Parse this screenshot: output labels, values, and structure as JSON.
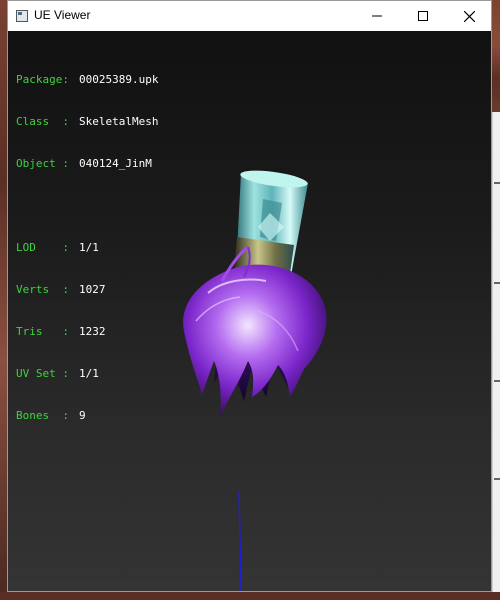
{
  "window": {
    "title": "UE Viewer",
    "controls": [
      "minimize",
      "maximize",
      "close"
    ]
  },
  "info": {
    "package": {
      "label": "Package:",
      "value": "00025389.upk"
    },
    "class": {
      "label": "Class  :",
      "value": "SkeletalMesh"
    },
    "object": {
      "label": "Object :",
      "value": "040124_JinM"
    },
    "lod": {
      "label": "LOD    :",
      "value": "1/1"
    },
    "verts": {
      "label": "Verts  :",
      "value": "1027"
    },
    "tris": {
      "label": "Tris   :",
      "value": "1232"
    },
    "uvset": {
      "label": "UV Set :",
      "value": "1/1"
    },
    "bones": {
      "label": "Bones  :",
      "value": "9"
    }
  },
  "colors": {
    "label": "#3fd23f",
    "value": "#ffffff",
    "viewport_top": "#111111",
    "viewport_bottom": "#343434",
    "hair_primary": "#9b3fd8",
    "cylinder": "#8fd6d0",
    "axis": "#1f1fd6"
  },
  "icons": [
    "app-icon",
    "minimize-icon",
    "maximize-icon",
    "close-icon"
  ]
}
